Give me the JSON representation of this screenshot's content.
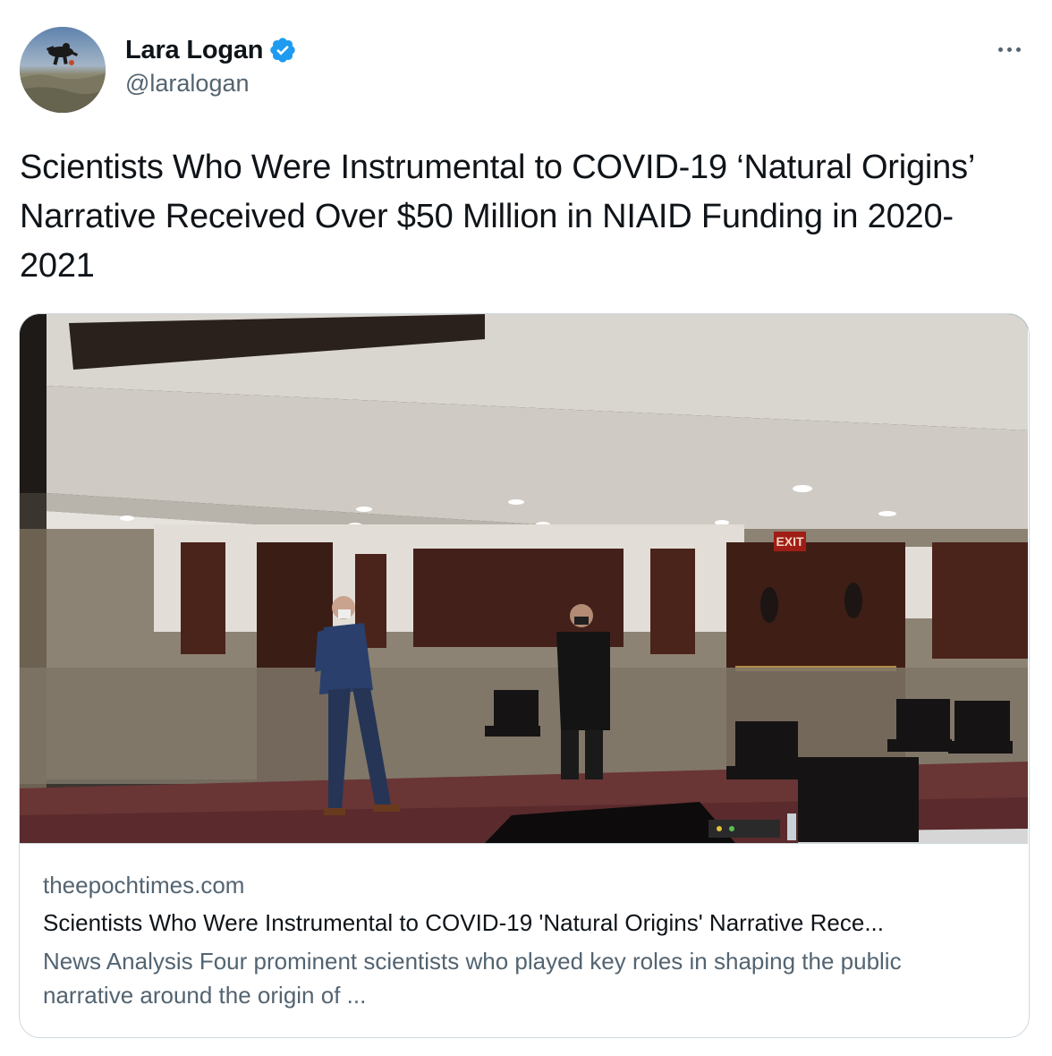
{
  "author": {
    "display_name": "Lara Logan",
    "handle": "@laralogan",
    "verified": true,
    "avatar_icon": "skydiver-photo-avatar"
  },
  "menu": {
    "icon": "more-horizontal-icon"
  },
  "tweet": {
    "text": "Scientists Who Were Instrumental to COVID-19 ‘Natural Origins’ Narrative Received Over $50 Million in NIAID Funding in 2020-2021"
  },
  "card": {
    "image_alt_icon": "hearing-room-photo",
    "domain": "theepochtimes.com",
    "title": "Scientists Who Were Instrumental to COVID-19 'Natural Origins' Narrative Rece...",
    "description": "News Analysis Four prominent scientists who played key roles in shaping the public narrative around the origin of ..."
  },
  "colors": {
    "text_primary": "#0f1419",
    "text_secondary": "#536471",
    "verified_blue": "#1d9bf0",
    "card_border": "#cfd9de"
  }
}
